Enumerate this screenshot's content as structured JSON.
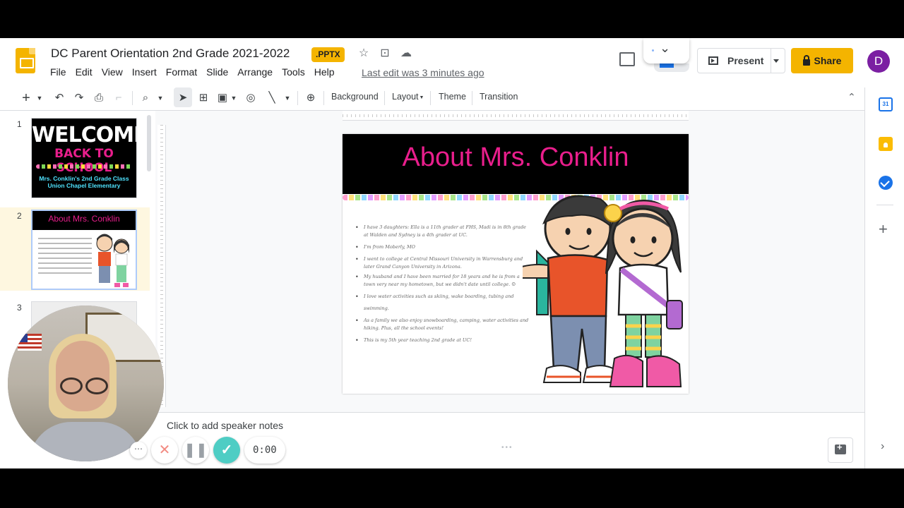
{
  "header": {
    "doc_title": "DC Parent Orientation 2nd Grade 2021-2022",
    "file_badge": ".PPTX",
    "last_edit": "Last edit was 3 minutes ago",
    "present_label": "Present",
    "share_label": "Share",
    "avatar_letter": "D"
  },
  "menu": [
    "File",
    "Edit",
    "View",
    "Insert",
    "Format",
    "Slide",
    "Arrange",
    "Tools",
    "Help"
  ],
  "toolbar": {
    "background_label": "Background",
    "layout_label": "Layout",
    "theme_label": "Theme",
    "transition_label": "Transition"
  },
  "filmstrip": {
    "slide_numbers": [
      "1",
      "2",
      "3"
    ],
    "slide1": {
      "line1": "WELCOME",
      "line2": "BACK TO SCHOOL",
      "sub1": "Mrs. Conklin's 2nd Grade Class",
      "sub2": "Union Chapel Elementary"
    },
    "slide2_title": "About Mrs. Conklin"
  },
  "slide": {
    "title": "About Mrs. Conklin",
    "bullets": [
      "I have 3 daughters: Ella is a 11th grader at FHS, Madi is in 8th grade at Walden and Sydney is a 4th grader at UC.",
      "I'm from Moberly, MO",
      "I went to college at Central Missouri University in Warrensburg and later Grand Canyon University in Arizona.",
      "My husband and I have been married for 18 years and he is from a town very near my hometown, but we didn't date until college. ☺",
      "I love water activities such as skiing, wake boarding, tubing and swimming.",
      "As a family we also enjoy snowboarding, camping, water activities and hiking. Plus, all the school events!",
      "This is my 5th year teaching 2nd grade at UC!"
    ]
  },
  "notes": {
    "placeholder": "Click to add speaker notes"
  },
  "recorder": {
    "timer": "0:00"
  },
  "side_panel": {
    "calendar_text": "31"
  }
}
